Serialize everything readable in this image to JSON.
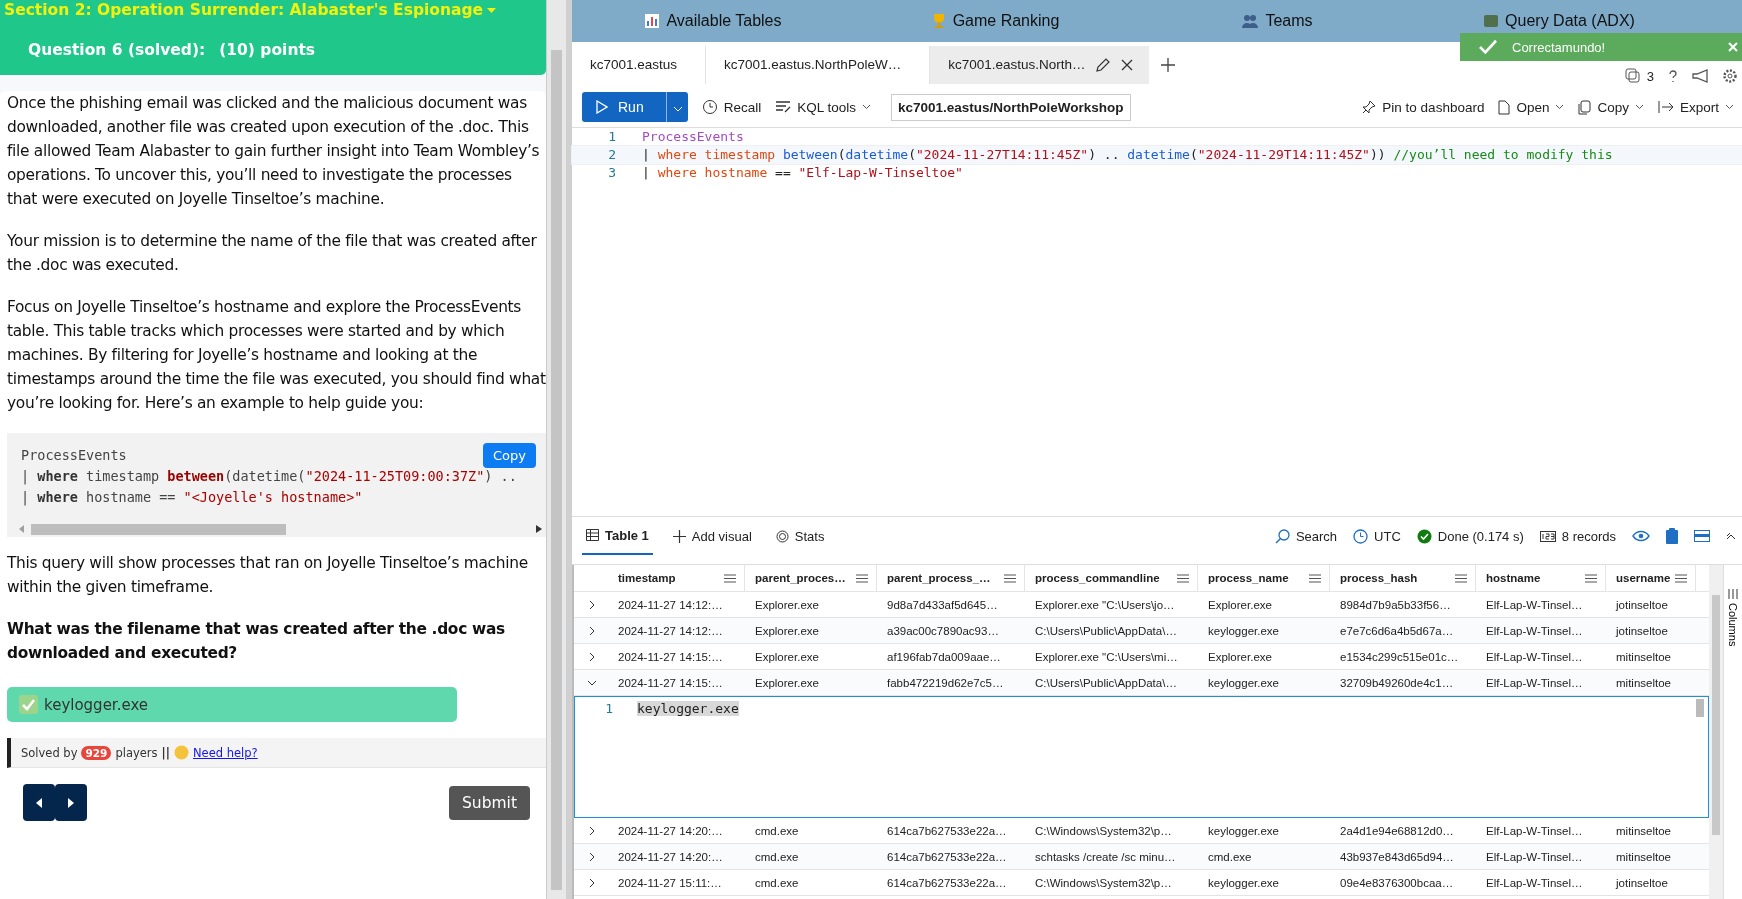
{
  "left": {
    "section_title": "Section 2: Operation Surrender: Alabaster's Espionage",
    "question_title": "Question 6 (solved):",
    "points": "(10) points",
    "paragraphs": [
      "Once the phishing email was clicked and the malicious document was downloaded, another file was created upon execution of the .doc. This file allowed Team Alabaster to gain further insight into Team Wombley’s operations. To uncover this, you’ll need to investigate the processes that were executed on Joyelle Tinseltoe’s machine.",
      "Your mission is to determine the name of the file that was created after the .doc was executed.",
      "Focus on Joyelle Tinseltoe’s hostname and explore the ProcessEvents table. This table tracks which processes were started and by which machines. By filtering for Joyelle’s hostname and looking at the timestamps around the time the file was executed, you should find what you’re looking for. Here’s an example to help guide you:"
    ],
    "code_lines": [
      [
        {
          "kind": "plain",
          "text": "ProcessEvents"
        }
      ],
      [
        {
          "kind": "plain",
          "text": "| "
        },
        {
          "kind": "keyword",
          "text": "where"
        },
        {
          "kind": "plain",
          "text": " timestamp "
        },
        {
          "kind": "operator",
          "text": "between"
        },
        {
          "kind": "plain",
          "text": "(datetime("
        },
        {
          "kind": "string",
          "text": "\"2024-11-25T09:00:37Z\""
        },
        {
          "kind": "plain",
          "text": ") .."
        }
      ],
      [
        {
          "kind": "plain",
          "text": "| "
        },
        {
          "kind": "keyword",
          "text": "where"
        },
        {
          "kind": "plain",
          "text": " hostname == "
        },
        {
          "kind": "string",
          "text": "\"<Joyelle's hostname>\""
        }
      ]
    ],
    "copy_button": "Copy",
    "after_code": "This query will show processes that ran on Joyelle Tinseltoe’s machine within the given timeframe.",
    "question": "What was the filename that was created after the .doc was downloaded and executed?",
    "answer": "keylogger.exe",
    "solved_prefix": "Solved by",
    "solved_count": "929",
    "solved_suffix": "players",
    "separator": "||",
    "help_link": "Need help?",
    "submit": "Submit"
  },
  "right": {
    "top_tabs": [
      {
        "kind": "tables",
        "label": "Available Tables"
      },
      {
        "kind": "ranking",
        "label": "Game Ranking"
      },
      {
        "kind": "teams",
        "label": "Teams"
      },
      {
        "kind": "query",
        "label": "Query Data (ADX)"
      }
    ],
    "toast": {
      "message": "Correctamundo!"
    },
    "query_tabs": [
      {
        "label": "kc7001.eastus",
        "selected": false
      },
      {
        "label": "kc7001.eastus.NorthPoleW…",
        "selected": false
      },
      {
        "label": "kc7001.eastus.North…",
        "selected": true
      }
    ],
    "tab_count": "3",
    "toolbar": {
      "run": "Run",
      "recall": "Recall",
      "kql_tools": "KQL tools",
      "database": "kc7001.eastus/NorthPoleWorkshop",
      "pin": "Pin to dashboard",
      "open": "Open",
      "copy": "Copy",
      "export": "Export"
    },
    "editor_lines": [
      {
        "number": "1",
        "tokens": [
          {
            "kind": "table",
            "text": "ProcessEvents"
          }
        ]
      },
      {
        "number": "2",
        "tokens": [
          {
            "kind": "plain",
            "text": "| "
          },
          {
            "kind": "keyword",
            "text": "where timestamp "
          },
          {
            "kind": "function",
            "text": "between"
          },
          {
            "kind": "plain",
            "text": "("
          },
          {
            "kind": "function",
            "text": "datetime"
          },
          {
            "kind": "plain",
            "text": "("
          },
          {
            "kind": "string",
            "text": "\"2024-11-27T14:11:45Z\""
          },
          {
            "kind": "plain",
            "text": ") .. "
          },
          {
            "kind": "function",
            "text": "datetime"
          },
          {
            "kind": "plain",
            "text": "("
          },
          {
            "kind": "string",
            "text": "\"2024-11-29T14:11:45Z\""
          },
          {
            "kind": "plain",
            "text": ")) "
          },
          {
            "kind": "comment",
            "text": "//you’ll need to modify this"
          }
        ]
      },
      {
        "number": "3",
        "tokens": [
          {
            "kind": "plain",
            "text": "| "
          },
          {
            "kind": "keyword",
            "text": "where hostname "
          },
          {
            "kind": "plain",
            "text": "== "
          },
          {
            "kind": "string",
            "text": "\"Elf-Lap-W-Tinseltoe\""
          }
        ]
      }
    ],
    "result_tabs": [
      {
        "kind": "table",
        "label": "Table 1",
        "selected": true
      },
      {
        "kind": "add",
        "label": "Add visual",
        "selected": false
      },
      {
        "kind": "stats",
        "label": "Stats",
        "selected": false
      }
    ],
    "status": {
      "search": "Search",
      "timezone": "UTC",
      "done": "Done (0.174 s)",
      "records": "8 records"
    },
    "columns": [
      "timestamp",
      "parent_proces…",
      "parent_process_…",
      "process_commandline",
      "process_name",
      "process_hash",
      "hostname",
      "username"
    ],
    "columns_panel": "Columns",
    "rows": [
      {
        "expanded": false,
        "cells": [
          "2024-11-27 14:12:…",
          "Explorer.exe",
          "9d8a7d433af5d645…",
          "Explorer.exe \"C:\\Users\\jo…",
          "Explorer.exe",
          "8984d7b9a5b33f56…",
          "Elf-Lap-W-Tinsel…",
          "jotinseltoe"
        ]
      },
      {
        "expanded": false,
        "cells": [
          "2024-11-27 14:12:…",
          "Explorer.exe",
          "a39ac00c7890ac93…",
          "C:\\Users\\Public\\AppData\\…",
          "keylogger.exe",
          "e7e7c6d6a4b5d67a…",
          "Elf-Lap-W-Tinsel…",
          "jotinseltoe"
        ]
      },
      {
        "expanded": false,
        "cells": [
          "2024-11-27 14:15:…",
          "Explorer.exe",
          "af196fab7da009aae…",
          "Explorer.exe \"C:\\Users\\mi…",
          "Explorer.exe",
          "e1534c299c515e01c…",
          "Elf-Lap-W-Tinsel…",
          "mitinseltoe"
        ]
      },
      {
        "expanded": true,
        "detail": {
          "line": "1",
          "text": "keylogger.exe"
        },
        "cells": [
          "2024-11-27 14:15:…",
          "Explorer.exe",
          "fabb472219d62e7c5…",
          "C:\\Users\\Public\\AppData\\…",
          "keylogger.exe",
          "32709b49260de4c1…",
          "Elf-Lap-W-Tinsel…",
          "mitinseltoe"
        ]
      },
      {
        "expanded": false,
        "cells": [
          "2024-11-27 14:20:…",
          "cmd.exe",
          "614ca7b627533e22a…",
          "C:\\Windows\\System32\\p…",
          "keylogger.exe",
          "2a4d1e94e68812d0…",
          "Elf-Lap-W-Tinsel…",
          "mitinseltoe"
        ]
      },
      {
        "expanded": false,
        "cells": [
          "2024-11-27 14:20:…",
          "cmd.exe",
          "614ca7b627533e22a…",
          "schtasks /create /sc minu…",
          "cmd.exe",
          "43b937e843d65d94…",
          "Elf-Lap-W-Tinsel…",
          "mitinseltoe"
        ]
      },
      {
        "expanded": false,
        "cells": [
          "2024-11-27 15:11:…",
          "cmd.exe",
          "614ca7b627533e22a…",
          "C:\\Windows\\System32\\p…",
          "keylogger.exe",
          "09e4e8376300bcaa…",
          "Elf-Lap-W-Tinsel…",
          "jotinseltoe"
        ]
      }
    ]
  }
}
